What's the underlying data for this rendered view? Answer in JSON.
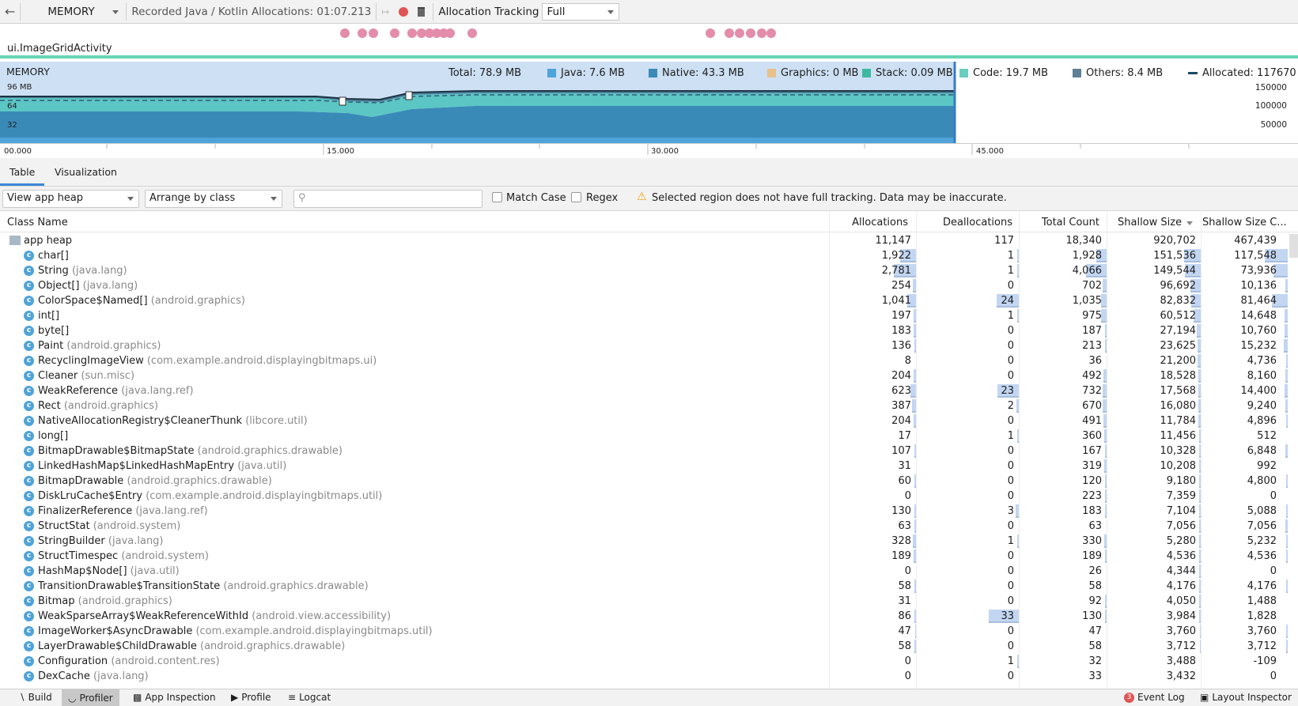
{
  "toolbar": {
    "profiler_select": "MEMORY",
    "recording_label": "Recorded Java / Kotlin Allocations: 01:07.213",
    "allocation_tracking_label": "Allocation Tracking",
    "allocation_tracking_value": "Full"
  },
  "events": {
    "activity": "ui.ImageGridActivity"
  },
  "memory_chart": {
    "title": "MEMORY",
    "y_max_label": "96 MB",
    "y_ticks": [
      "64",
      "32"
    ],
    "legend": {
      "total": "Total: 78.9 MB",
      "java": "Java: 7.6 MB",
      "native": "Native: 43.3 MB",
      "graphics": "Graphics: 0 MB",
      "stack": "Stack: 0.09 MB",
      "code": "Code: 19.7 MB",
      "others": "Others: 8.4 MB",
      "allocated": "Allocated: 117670"
    },
    "right_ticks": [
      "150000",
      "100000",
      "50000"
    ],
    "time_ticks": [
      "00.000",
      "15.000",
      "30.000",
      "45.000"
    ],
    "colors": {
      "java": "#4fa3d8",
      "native": "#3a8ab8",
      "graphics": "#e8c08a",
      "stack": "#3fb8a0",
      "code": "#5bc6c4",
      "others": "#5f7f95",
      "selection": "#cde0f4"
    }
  },
  "tabs": [
    "Table",
    "Visualization"
  ],
  "filters": {
    "heap": "View app heap",
    "arrange": "Arrange by class",
    "search_placeholder": "",
    "match_case": "Match Case",
    "regex": "Regex",
    "warning": "Selected region does not have full tracking. Data may be inaccurate."
  },
  "table": {
    "columns": [
      "Class Name",
      "Allocations",
      "Deallocations",
      "Total Count",
      "Shallow Size",
      "Shallow Size C..."
    ],
    "root": {
      "name": "app heap",
      "values": [
        "11,147",
        "117",
        "18,340",
        "920,702",
        "467,439"
      ]
    },
    "rows": [
      {
        "name": "char[]",
        "pkg": "",
        "values": [
          "1,922",
          "1",
          "1,928",
          "151,536",
          "117,548"
        ]
      },
      {
        "name": "String",
        "pkg": "(java.lang)",
        "values": [
          "2,781",
          "1",
          "4,066",
          "149,544",
          "73,936"
        ]
      },
      {
        "name": "Object[]",
        "pkg": "(java.lang)",
        "values": [
          "254",
          "0",
          "702",
          "96,692",
          "10,136"
        ]
      },
      {
        "name": "ColorSpace$Named[]",
        "pkg": "(android.graphics)",
        "values": [
          "1,041",
          "24",
          "1,035",
          "82,832",
          "81,464"
        ]
      },
      {
        "name": "int[]",
        "pkg": "",
        "values": [
          "197",
          "1",
          "975",
          "60,512",
          "14,648"
        ]
      },
      {
        "name": "byte[]",
        "pkg": "",
        "values": [
          "183",
          "0",
          "187",
          "27,194",
          "10,760"
        ]
      },
      {
        "name": "Paint",
        "pkg": "(android.graphics)",
        "values": [
          "136",
          "0",
          "213",
          "23,625",
          "15,232"
        ]
      },
      {
        "name": "RecyclingImageView",
        "pkg": "(com.example.android.displayingbitmaps.ui)",
        "values": [
          "8",
          "0",
          "36",
          "21,200",
          "4,736"
        ]
      },
      {
        "name": "Cleaner",
        "pkg": "(sun.misc)",
        "values": [
          "204",
          "0",
          "492",
          "18,528",
          "8,160"
        ]
      },
      {
        "name": "WeakReference",
        "pkg": "(java.lang.ref)",
        "values": [
          "623",
          "23",
          "732",
          "17,568",
          "14,400"
        ]
      },
      {
        "name": "Rect",
        "pkg": "(android.graphics)",
        "values": [
          "387",
          "2",
          "670",
          "16,080",
          "9,240"
        ]
      },
      {
        "name": "NativeAllocationRegistry$CleanerThunk",
        "pkg": "(libcore.util)",
        "values": [
          "204",
          "0",
          "491",
          "11,784",
          "4,896"
        ]
      },
      {
        "name": "long[]",
        "pkg": "",
        "values": [
          "17",
          "1",
          "360",
          "11,456",
          "512"
        ]
      },
      {
        "name": "BitmapDrawable$BitmapState",
        "pkg": "(android.graphics.drawable)",
        "values": [
          "107",
          "0",
          "167",
          "10,328",
          "6,848"
        ]
      },
      {
        "name": "LinkedHashMap$LinkedHashMapEntry",
        "pkg": "(java.util)",
        "values": [
          "31",
          "0",
          "319",
          "10,208",
          "992"
        ]
      },
      {
        "name": "BitmapDrawable",
        "pkg": "(android.graphics.drawable)",
        "values": [
          "60",
          "0",
          "120",
          "9,180",
          "4,800"
        ]
      },
      {
        "name": "DiskLruCache$Entry",
        "pkg": "(com.example.android.displayingbitmaps.util)",
        "values": [
          "0",
          "0",
          "223",
          "7,359",
          "0"
        ]
      },
      {
        "name": "FinalizerReference",
        "pkg": "(java.lang.ref)",
        "values": [
          "130",
          "3",
          "183",
          "7,104",
          "5,088"
        ]
      },
      {
        "name": "StructStat",
        "pkg": "(android.system)",
        "values": [
          "63",
          "0",
          "63",
          "7,056",
          "7,056"
        ]
      },
      {
        "name": "StringBuilder",
        "pkg": "(java.lang)",
        "values": [
          "328",
          "1",
          "330",
          "5,280",
          "5,232"
        ]
      },
      {
        "name": "StructTimespec",
        "pkg": "(android.system)",
        "values": [
          "189",
          "0",
          "189",
          "4,536",
          "4,536"
        ]
      },
      {
        "name": "HashMap$Node[]",
        "pkg": "(java.util)",
        "values": [
          "0",
          "0",
          "26",
          "4,344",
          "0"
        ]
      },
      {
        "name": "TransitionDrawable$TransitionState",
        "pkg": "(android.graphics.drawable)",
        "values": [
          "58",
          "0",
          "58",
          "4,176",
          "4,176"
        ]
      },
      {
        "name": "Bitmap",
        "pkg": "(android.graphics)",
        "values": [
          "31",
          "0",
          "92",
          "4,050",
          "1,488"
        ]
      },
      {
        "name": "WeakSparseArray$WeakReferenceWithId",
        "pkg": "(android.view.accessibility)",
        "values": [
          "86",
          "33",
          "130",
          "3,984",
          "1,828"
        ]
      },
      {
        "name": "ImageWorker$AsyncDrawable",
        "pkg": "(com.example.android.displayingbitmaps.util)",
        "values": [
          "47",
          "0",
          "47",
          "3,760",
          "3,760"
        ]
      },
      {
        "name": "LayerDrawable$ChildDrawable",
        "pkg": "(android.graphics.drawable)",
        "values": [
          "58",
          "0",
          "58",
          "3,712",
          "3,712"
        ]
      },
      {
        "name": "Configuration",
        "pkg": "(android.content.res)",
        "values": [
          "0",
          "1",
          "32",
          "3,488",
          "-109"
        ]
      },
      {
        "name": "DexCache",
        "pkg": "(java.lang)",
        "values": [
          "0",
          "0",
          "33",
          "3,432",
          "0"
        ]
      }
    ]
  },
  "bottom": {
    "left": [
      "Build",
      "Profiler",
      "App Inspection",
      "Profile",
      "Logcat"
    ],
    "right": [
      "Event Log",
      "Layout Inspector"
    ],
    "event_log_badge": "3"
  }
}
